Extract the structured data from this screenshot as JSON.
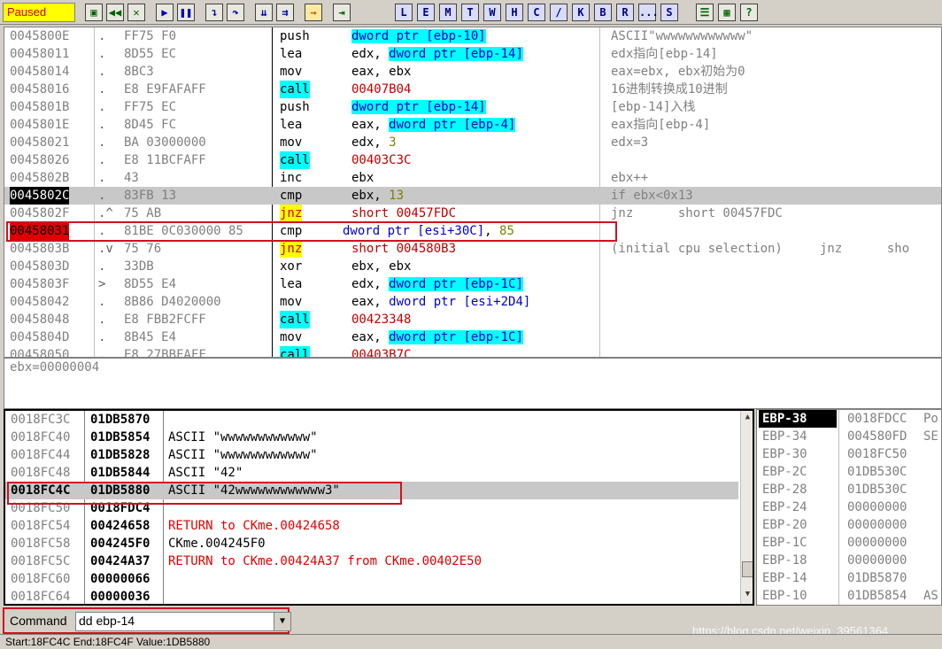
{
  "toolbar": {
    "status": "Paused",
    "buttons": [
      {
        "name": "open-button",
        "glyph": "▣",
        "cls": "g"
      },
      {
        "name": "restart-button",
        "glyph": "◀◀",
        "cls": "g"
      },
      {
        "name": "close-button",
        "glyph": "✕",
        "cls": "g"
      },
      {
        "name": "run-button",
        "glyph": "▶",
        "cls": "b"
      },
      {
        "name": "pause-button",
        "glyph": "❚❚",
        "cls": "b"
      },
      {
        "name": "step-into-button",
        "glyph": "↴",
        "cls": "b"
      },
      {
        "name": "step-over-button",
        "glyph": "↷",
        "cls": "b"
      },
      {
        "name": "trace-into-button",
        "glyph": "⇊",
        "cls": "b"
      },
      {
        "name": "trace-over-button",
        "glyph": "⇉",
        "cls": "b"
      },
      {
        "name": "execute-till-return-button",
        "glyph": "→",
        "cls": "o"
      },
      {
        "name": "go-to-button",
        "glyph": "⇥",
        "cls": "g"
      }
    ],
    "window_buttons": [
      "L",
      "E",
      "M",
      "T",
      "W",
      "H",
      "C",
      "/",
      "K",
      "B",
      "R",
      "...",
      "S"
    ],
    "extra_buttons": [
      "☰",
      "▦",
      "?"
    ]
  },
  "disasm": {
    "rows": [
      {
        "addr": "0045800E",
        "mark": ".",
        "hex": "FF75 F0",
        "mn": "push",
        "op": [
          [
            "hl",
            "dword ptr [ebp-10]"
          ]
        ],
        "cm": "ASCII\"wwwwwwwwwwww\""
      },
      {
        "addr": "00458011",
        "mark": ".",
        "hex": "8D55 EC",
        "mn": "lea",
        "op": [
          [
            "reg",
            "edx, "
          ],
          [
            "hl",
            "dword ptr [ebp-14]"
          ]
        ],
        "cm": "edx指向[ebp-14]"
      },
      {
        "addr": "00458014",
        "mark": ".",
        "hex": "8BC3",
        "mn": "mov",
        "op": [
          [
            "reg",
            "eax, ebx"
          ]
        ],
        "cm": "eax=ebx, ebx初始为0"
      },
      {
        "addr": "00458016",
        "mark": ".",
        "hex": "E8 E9FAFAFF",
        "mn": "call",
        "op": [
          [
            "brown",
            "00407B04"
          ]
        ],
        "cm": "16进制转换成10进制"
      },
      {
        "addr": "0045801B",
        "mark": ".",
        "hex": "FF75 EC",
        "mn": "push",
        "op": [
          [
            "hl",
            "dword ptr [ebp-14]"
          ]
        ],
        "cm": "[ebp-14]入栈"
      },
      {
        "addr": "0045801E",
        "mark": ".",
        "hex": "8D45 FC",
        "mn": "lea",
        "op": [
          [
            "reg",
            "eax, "
          ],
          [
            "hl",
            "dword ptr [ebp-4]"
          ]
        ],
        "cm": "eax指向[ebp-4]"
      },
      {
        "addr": "00458021",
        "mark": ".",
        "hex": "BA 03000000",
        "mn": "mov",
        "op": [
          [
            "reg",
            "edx, "
          ],
          [
            "num",
            "3"
          ]
        ],
        "cm": "edx=3"
      },
      {
        "addr": "00458026",
        "mark": ".",
        "hex": "E8 11BCFAFF",
        "mn": "call",
        "op": [
          [
            "brown",
            "00403C3C"
          ]
        ],
        "cm": ""
      },
      {
        "addr": "0045802B",
        "mark": ".",
        "hex": "43",
        "mn": "inc",
        "op": [
          [
            "reg",
            "ebx"
          ]
        ],
        "cm": "ebx++"
      },
      {
        "addr": "0045802C",
        "mark": ".",
        "hex": "83FB 13",
        "mn": "cmp",
        "op": [
          [
            "reg",
            "ebx, "
          ],
          [
            "num",
            "13"
          ]
        ],
        "cm": "if ebx<0x13",
        "sel": true,
        "addrstyle": "black"
      },
      {
        "addr": "0045802F",
        "mark": ".^",
        "hex": "75 AB",
        "mn": "jnz",
        "op": [
          [
            "brown",
            "short 00457FDC"
          ]
        ],
        "cm": "jnz      short 00457FDC"
      },
      {
        "addr": "00458031",
        "mark": ".",
        "hex": "81BE 0C030000 85",
        "mn": "cmp",
        "op": [
          [
            "blue",
            "dword ptr [esi+30C]"
          ],
          [
            "reg",
            ", "
          ],
          [
            "num",
            "85"
          ]
        ],
        "cm": "",
        "addrstyle": "red",
        "shift": true
      },
      {
        "addr": "0045803B",
        "mark": ".v",
        "hex": "75 76",
        "mn": "jnz",
        "op": [
          [
            "brown",
            "short 004580B3"
          ]
        ],
        "cm": "(initial cpu selection)     jnz      sho"
      },
      {
        "addr": "0045803D",
        "mark": ".",
        "hex": "33DB",
        "mn": "xor",
        "op": [
          [
            "reg",
            "ebx, ebx"
          ]
        ],
        "cm": ""
      },
      {
        "addr": "0045803F",
        "mark": ">",
        "hex": "8D55 E4",
        "mn": "lea",
        "op": [
          [
            "reg",
            "edx, "
          ],
          [
            "hl",
            "dword ptr [ebp-1C]"
          ]
        ],
        "cm": ""
      },
      {
        "addr": "00458042",
        "mark": ".",
        "hex": "8B86 D4020000",
        "mn": "mov",
        "op": [
          [
            "reg",
            "eax, "
          ],
          [
            "blue",
            "dword ptr [esi+2D4]"
          ]
        ],
        "cm": ""
      },
      {
        "addr": "00458048",
        "mark": ".",
        "hex": "E8 FBB2FCFF",
        "mn": "call",
        "op": [
          [
            "brown",
            "00423348"
          ]
        ],
        "cm": ""
      },
      {
        "addr": "0045804D",
        "mark": ".",
        "hex": "8B45 E4",
        "mn": "mov",
        "op": [
          [
            "reg",
            "eax, "
          ],
          [
            "hl",
            "dword ptr [ebp-1C]"
          ]
        ],
        "cm": ""
      },
      {
        "addr": "00458050",
        "mark": ".",
        "hex": "E8 27BBFAFF",
        "mn": "call",
        "op": [
          [
            "brown",
            "00403B7C"
          ]
        ],
        "cm": ""
      }
    ]
  },
  "info": {
    "text": "ebx=00000004"
  },
  "stack": {
    "rows": [
      {
        "addr": "0018FC3C",
        "val": "01DB5870",
        "cm": "",
        "type": ""
      },
      {
        "addr": "0018FC40",
        "val": "01DB5854",
        "cm": "ASCII \"wwwwwwwwwwww\"",
        "type": ""
      },
      {
        "addr": "0018FC44",
        "val": "01DB5828",
        "cm": "ASCII \"wwwwwwwwwwww\"",
        "type": ""
      },
      {
        "addr": "0018FC48",
        "val": "01DB5844",
        "cm": "ASCII \"42\"",
        "type": ""
      },
      {
        "addr": "0018FC4C",
        "val": "01DB5880",
        "cm": "ASCII \"42wwwwwwwwwwww3\"",
        "type": "sel"
      },
      {
        "addr": "0018FC50",
        "val": "0018FDC4",
        "cm": "",
        "type": ""
      },
      {
        "addr": "0018FC54",
        "val": "00424658",
        "cm": "RETURN to CKme.00424658",
        "type": "ret"
      },
      {
        "addr": "0018FC58",
        "val": "004245F0",
        "cm": "CKme.004245F0",
        "type": ""
      },
      {
        "addr": "0018FC5C",
        "val": "00424A37",
        "cm": "RETURN to CKme.00424A37 from CKme.00402E50",
        "type": "ret"
      },
      {
        "addr": "0018FC60",
        "val": "00000066",
        "cm": "",
        "type": ""
      },
      {
        "addr": "0018FC64",
        "val": "00000036",
        "cm": "",
        "type": ""
      }
    ]
  },
  "regs": {
    "rows": [
      {
        "lab": "EBP-38",
        "val": "0018FDCC",
        "ex": "Po",
        "sel": true
      },
      {
        "lab": "EBP-34",
        "val": "004580FD",
        "ex": "SE"
      },
      {
        "lab": "EBP-30",
        "val": "0018FC50",
        "ex": ""
      },
      {
        "lab": "EBP-2C",
        "val": "01DB530C",
        "ex": ""
      },
      {
        "lab": "EBP-28",
        "val": "01DB530C",
        "ex": ""
      },
      {
        "lab": "EBP-24",
        "val": "00000000",
        "ex": ""
      },
      {
        "lab": "EBP-20",
        "val": "00000000",
        "ex": ""
      },
      {
        "lab": "EBP-1C",
        "val": "00000000",
        "ex": ""
      },
      {
        "lab": "EBP-18",
        "val": "00000000",
        "ex": ""
      },
      {
        "lab": "EBP-14",
        "val": "01DB5870",
        "ex": ""
      },
      {
        "lab": "EBP-10",
        "val": "01DB5854",
        "ex": "AS"
      }
    ]
  },
  "command": {
    "label": "Command",
    "value": "dd ebp-14"
  },
  "watermark": "https://blog.csdn.net/weixin_39561364",
  "statusbar": "Start:18FC4C End:18FC4F Value:1DB5880"
}
